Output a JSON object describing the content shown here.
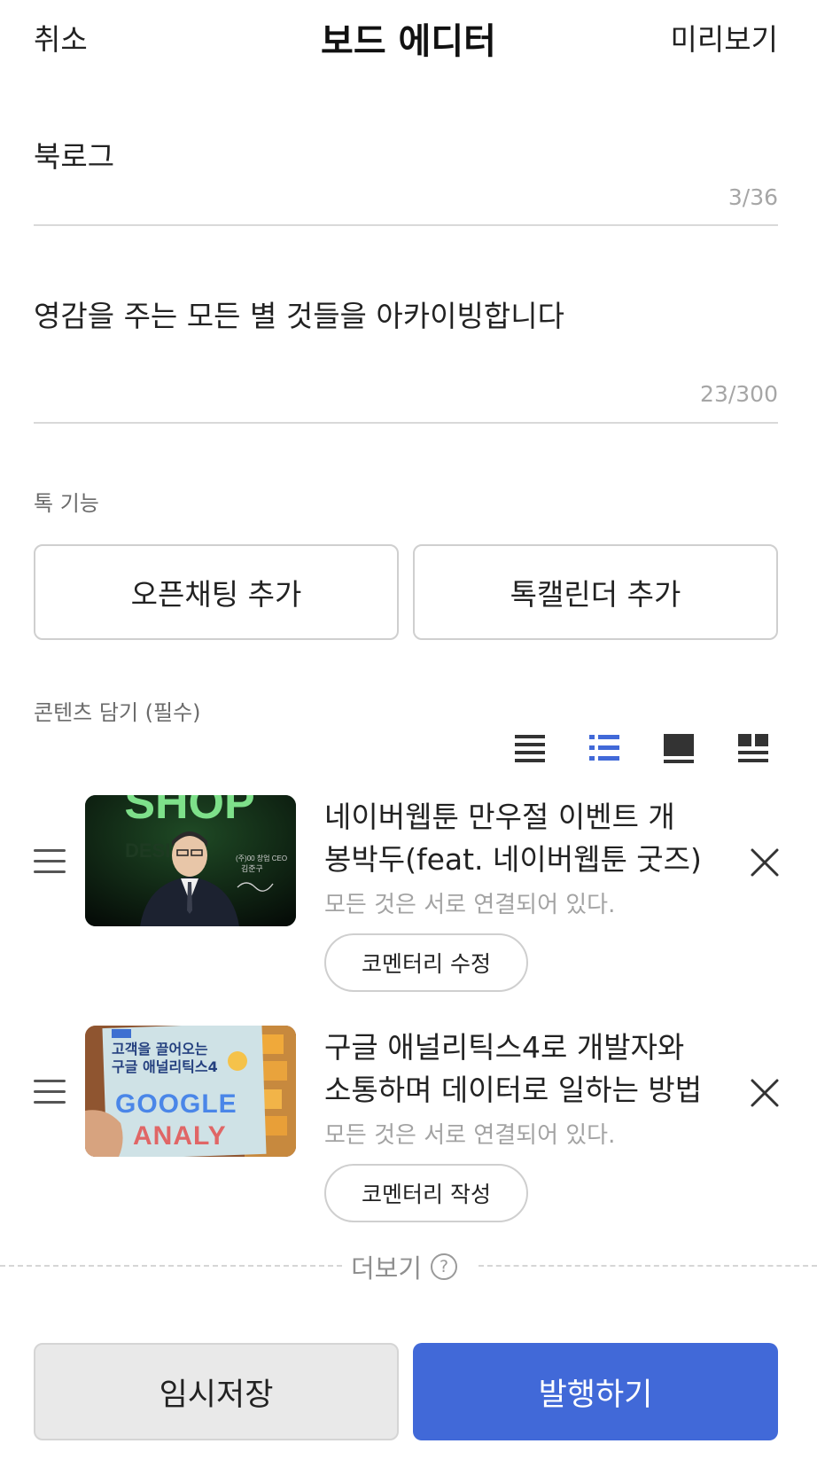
{
  "header": {
    "cancel": "취소",
    "title": "보드 에디터",
    "preview": "미리보기"
  },
  "board_name": {
    "value": "북로그",
    "count": "3/36"
  },
  "board_desc": {
    "value": "영감을 주는 모든 별 것들을 아카이빙합니다",
    "count": "23/300"
  },
  "talk_section": {
    "label": "톡 기능",
    "open_chat_button": "오픈채팅 추가",
    "talk_calendar_button": "톡캘린더 추가"
  },
  "content_section": {
    "label": "콘텐츠 담기 (필수)",
    "view_modes": [
      "list-icon",
      "bulleted-list-icon",
      "card-icon",
      "grid-icon"
    ],
    "selected_view_mode": "bulleted-list-icon",
    "accent_color": "#4169d8"
  },
  "items": [
    {
      "title_line1": "네이버웹툰 만우절 이벤트 개",
      "title_line2": "봉박두(feat. 네이버웹툰 굿즈)",
      "subtitle": "모든 것은 서로 연결되어 있다.",
      "commentary_button": "코멘터리 수정",
      "thumb_text": "SHOP",
      "thumb_caption_line1": "(주)00 창업 CEO",
      "thumb_caption_line2": "김준구"
    },
    {
      "title_line1": "구글 애널리틱스4로 개발자와",
      "title_line2": "소통하며 데이터로 일하는 방법",
      "subtitle": "모든 것은 서로 연결되어 있다.",
      "commentary_button": "코멘터리 작성",
      "thumb_text_top1": "고객을 끌어오는",
      "thumb_text_top2": "구글 애널리틱스4",
      "thumb_text_big1": "GOOGLE",
      "thumb_text_big2": "ANALY"
    }
  ],
  "more": {
    "label": "더보기",
    "help": "?"
  },
  "footer": {
    "save_draft": "임시저장",
    "publish": "발행하기",
    "publish_color": "#4169d8"
  }
}
